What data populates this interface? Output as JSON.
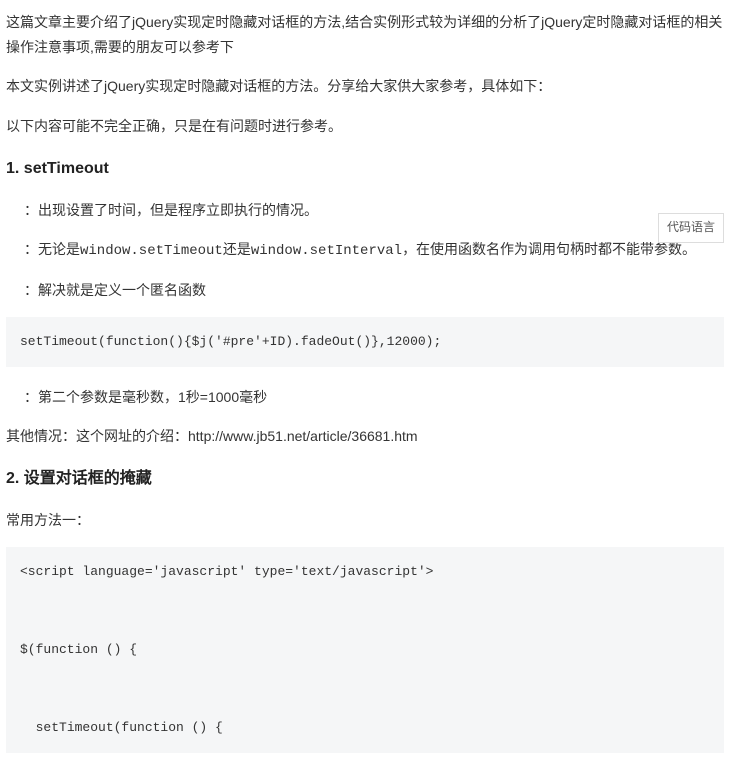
{
  "intro": "这篇文章主要介绍了jQuery实现定时隐藏对话框的方法,结合实例形式较为详细的分析了jQuery定时隐藏对话框的相关操作注意事项,需要的朋友可以参考下",
  "para1": "本文实例讲述了jQuery实现定时隐藏对话框的方法。分享给大家供大家参考，具体如下：",
  "para2": "以下内容可能不完全正确，只是在有问题时进行参考。",
  "section1": {
    "title": "1. setTimeout",
    "items": [
      "：出现设置了时间，但是程序立即执行的情况。",
      "：无论是window.setTimeout还是window.setInterval，在使用函数名作为调用句柄时都不能带参数。",
      "：解决就是定义一个匿名函数"
    ],
    "code": "setTimeout(function(){$j('#pre'+ID).fadeOut()},12000);",
    "item4": "：第二个参数是毫秒数，1秒=1000毫秒",
    "other_prefix": "其他情况：这个网址的介绍：",
    "other_url": "http://www.jb51.net/article/36681.htm"
  },
  "section2": {
    "title": "2. 设置对话框的掩藏",
    "para": "常用方法一：",
    "code": "<script language='javascript' type='text/javascript'>\n\n\n$(function () {\n\n\n  setTimeout(function () {"
  },
  "badge": "代码语言"
}
